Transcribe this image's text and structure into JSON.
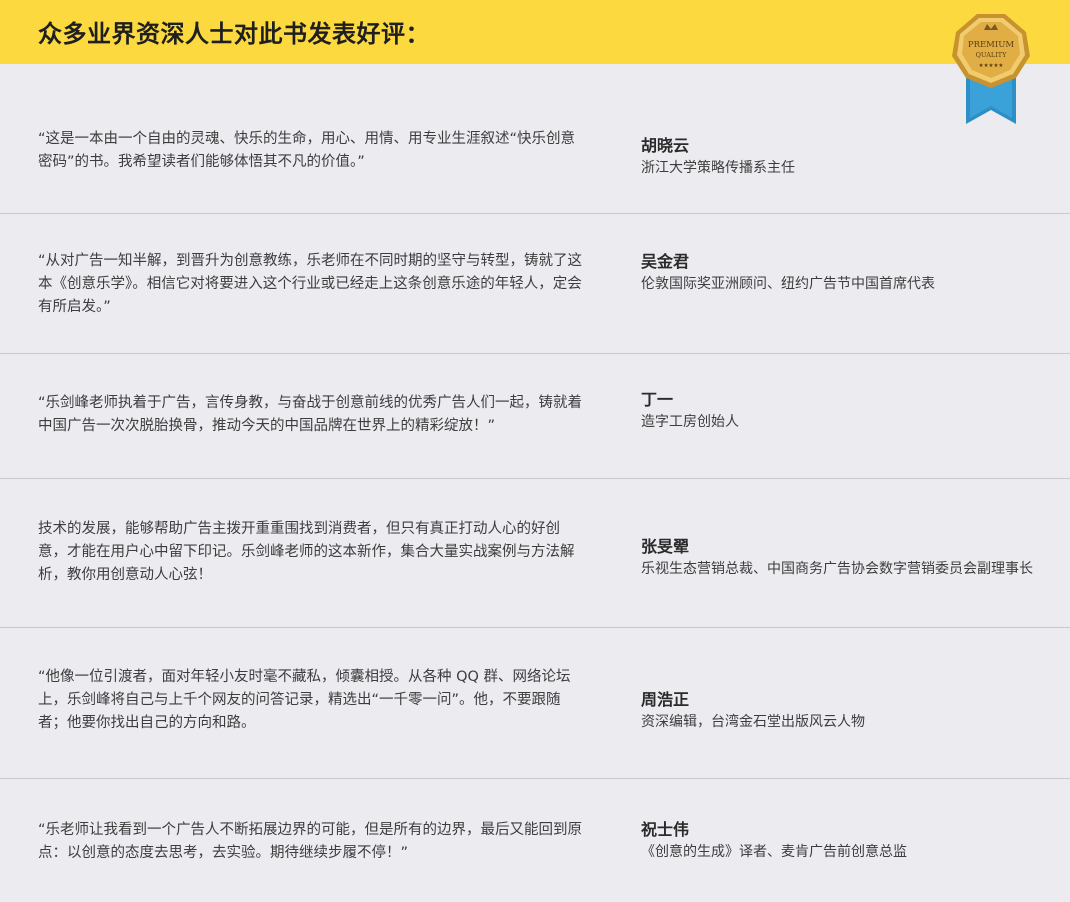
{
  "header": {
    "title": "众多业界资深人士对此书发表好评：",
    "badge": {
      "line1": "PREMIUM",
      "line2": "QUALITY",
      "stars": "★★★★★",
      "colors": {
        "gold": "#d9a83a",
        "ribbon": "#2d8fc6",
        "inner": "#7a5a22"
      }
    }
  },
  "reviews": [
    {
      "quote": "“这是一本由一个自由的灵魂、快乐的生命，用心、用情、用专业生涯叙述“快乐创意密码”的书。我希望读者们能够体悟其不凡的价值。”",
      "name": "胡晓云",
      "title": "浙江大学策略传播系主任"
    },
    {
      "quote": "“从对广告一知半解，到晋升为创意教练，乐老师在不同时期的坚守与转型，铸就了这本《创意乐学》。相信它对将要进入这个行业或已经走上这条创意乐途的年轻人，定会有所启发。”",
      "name": "吴金君",
      "title": "伦敦国际奖亚洲顾问、纽约广告节中国首席代表"
    },
    {
      "quote": "“乐剑峰老师执着于广告，言传身教，与奋战于创意前线的优秀广告人们一起，铸就着中国广告一次次脱胎换骨，推动今天的中国品牌在世界上的精彩绽放！”",
      "name": "丁一",
      "title": "造字工房创始人"
    },
    {
      "quote": "技术的发展，能够帮助广告主拨开重重围找到消费者，但只有真正打动人心的好创意，才能在用户心中留下印记。乐剑峰老师的这本新作，集合大量实战案例与方法解析，教你用创意动人心弦！",
      "name": "张旻翚",
      "title": "乐视生态营销总裁、中国商务广告协会数字营销委员会副理事长"
    },
    {
      "quote": "“他像一位引渡者，面对年轻小友时毫不藏私，倾囊相授。从各种 QQ 群、网络论坛上，乐剑峰将自己与上千个网友的问答记录，精选出“一千零一问”。他，不要跟随者；他要你找出自己的方向和路。",
      "name": "周浩正",
      "title": "资深编辑，台湾金石堂出版风云人物"
    },
    {
      "quote": "“乐老师让我看到一个广告人不断拓展边界的可能，但是所有的边界，最后又能回到原点：以创意的态度去思考，去实验。期待继续步履不停！”",
      "name": "祝士伟",
      "title": "《创意的生成》译者、麦肯广告前创意总监"
    }
  ]
}
